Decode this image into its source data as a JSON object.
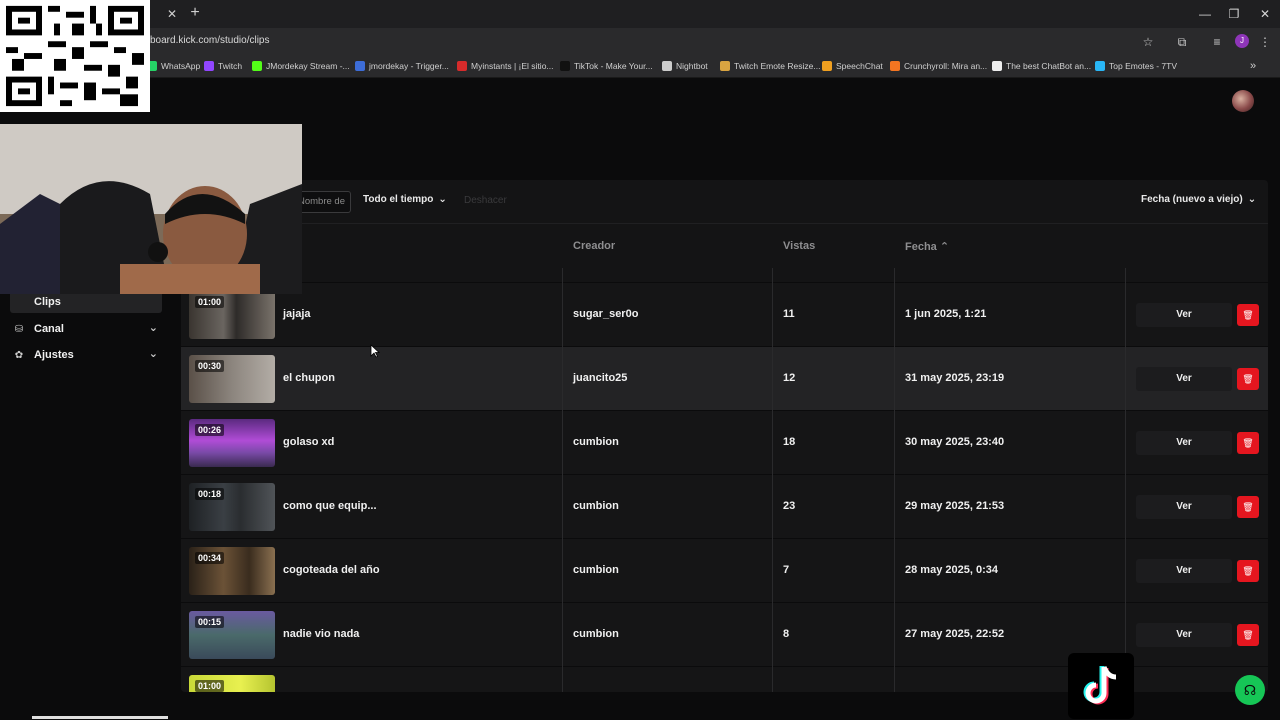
{
  "browser": {
    "url": "board.kick.com/studio/clips",
    "bookmarks": [
      {
        "label": "WhatsApp",
        "icon_color": "#25d366"
      },
      {
        "label": "Twitch",
        "icon_color": "#9146ff"
      },
      {
        "label": "JMordekay Stream -...",
        "icon_color": "#53fc18"
      },
      {
        "label": "jmordekay - Trigger...",
        "icon_color": "#3d6dd8"
      },
      {
        "label": "Myinstants | ¡El sitio...",
        "icon_color": "#d62b2b"
      },
      {
        "label": "TikTok - Make Your...",
        "icon_color": "#111111"
      },
      {
        "label": "Nightbot",
        "icon_color": "#cccccc"
      },
      {
        "label": "Twitch Emote Resize...",
        "icon_color": "#d9a441"
      },
      {
        "label": "SpeechChat",
        "icon_color": "#f0a020"
      },
      {
        "label": "Crunchyroll: Mira an...",
        "icon_color": "#f47521"
      },
      {
        "label": "The best ChatBot an...",
        "icon_color": "#eeeeee"
      },
      {
        "label": "Top Emotes - 7TV",
        "icon_color": "#29b6f6"
      }
    ],
    "profile_initial": "J"
  },
  "sidebar": {
    "items": [
      {
        "label": "Clips",
        "icon": "",
        "active": true
      },
      {
        "label": "Canal",
        "icon": "broadcast-icon",
        "active": false
      },
      {
        "label": "Ajustes",
        "icon": "gear-icon",
        "active": false
      }
    ]
  },
  "toolbar": {
    "search_placeholder": "Nombre de",
    "filter_label": "Todo el tiempo",
    "clear_label": "Deshacer",
    "sort_label": "Fecha (nuevo a viejo)"
  },
  "table": {
    "headers": {
      "creator": "Creador",
      "views": "Vistas",
      "date": "Fecha"
    },
    "view_label": "Ver",
    "rows": [
      {
        "duration": "01:00",
        "title": "jajaja",
        "creator": "sugar_ser0o",
        "views": "11",
        "date": "1 jun 2025, 1:21"
      },
      {
        "duration": "00:30",
        "title": "el chupon",
        "creator": "juancito25",
        "views": "12",
        "date": "31 may 2025, 23:19"
      },
      {
        "duration": "00:26",
        "title": "golaso xd",
        "creator": "cumbion",
        "views": "18",
        "date": "30 may 2025, 23:40"
      },
      {
        "duration": "00:18",
        "title": "como que equip...",
        "creator": "cumbion",
        "views": "23",
        "date": "29 may 2025, 21:53"
      },
      {
        "duration": "00:34",
        "title": "cogoteada del año",
        "creator": "cumbion",
        "views": "7",
        "date": "28 may 2025, 0:34"
      },
      {
        "duration": "00:15",
        "title": "nadie vio nada",
        "creator": "cumbion",
        "views": "8",
        "date": "27 may 2025, 22:52"
      },
      {
        "duration": "01:00",
        "title": "",
        "creator": "",
        "views": "",
        "date": ""
      }
    ]
  },
  "colors": {
    "accent": "#53fc18",
    "delete": "#e5161f",
    "help": "#16c656"
  }
}
